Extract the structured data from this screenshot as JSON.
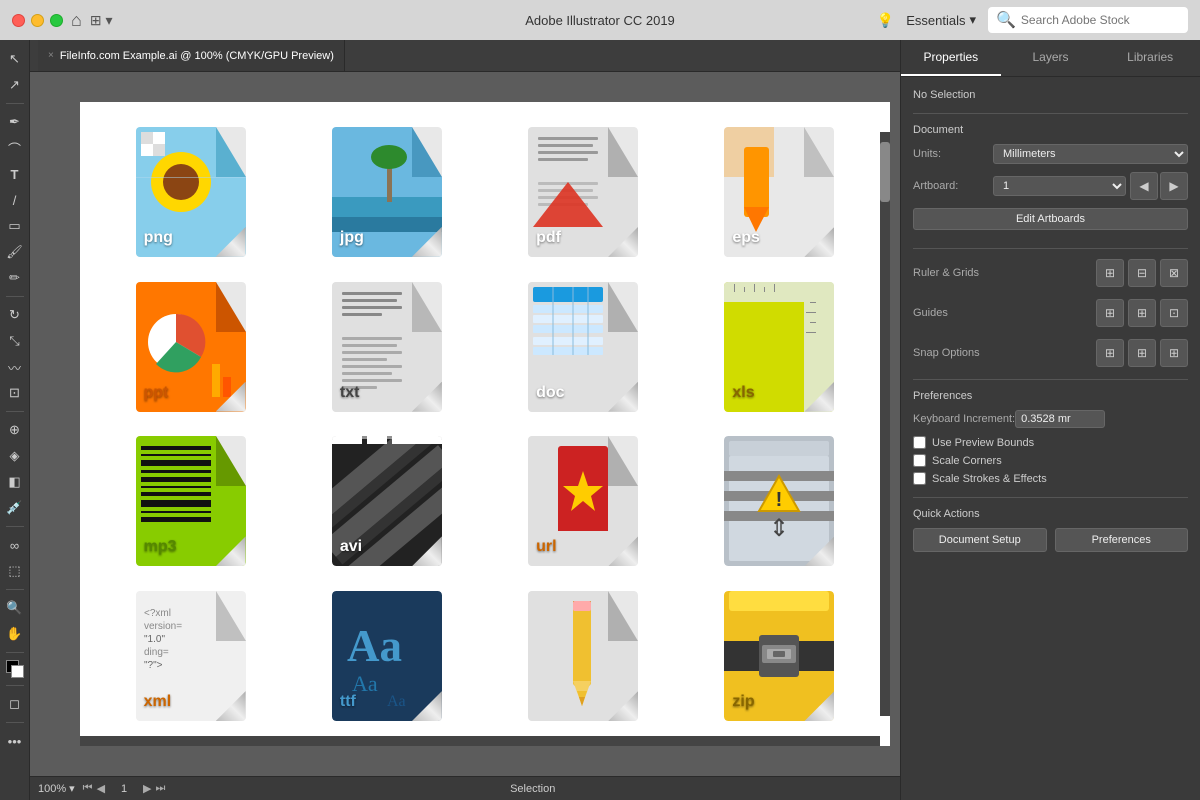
{
  "titlebar": {
    "title": "Adobe Illustrator CC 2019",
    "traffic": [
      "close",
      "minimize",
      "maximize"
    ],
    "home_label": "⌂",
    "grid_label": "⊞",
    "bulb_label": "💡",
    "essentials_label": "Essentials",
    "search_placeholder": "Search Adobe Stock"
  },
  "tab": {
    "label": "FileInfo.com Example.ai @ 100% (CMYK/GPU Preview)",
    "close": "×"
  },
  "bottom_bar": {
    "zoom": "100%",
    "artboard": "1",
    "selection": "Selection",
    "nav_prev_prev": "⏮",
    "nav_prev": "◀",
    "nav_next": "▶",
    "nav_next_next": "⏭"
  },
  "right_panel": {
    "tabs": [
      "Properties",
      "Layers",
      "Libraries"
    ],
    "active_tab": "Properties",
    "no_selection": "No Selection",
    "document_section": "Document",
    "units_label": "Units:",
    "units_value": "Millimeters",
    "artboard_label": "Artboard:",
    "artboard_value": "1",
    "edit_artboards_btn": "Edit Artboards",
    "ruler_grids": "Ruler & Grids",
    "guides": "Guides",
    "snap_options": "Snap Options",
    "preferences_section": "Preferences",
    "keyboard_increment_label": "Keyboard Increment:",
    "keyboard_increment_value": "0.3528 mr",
    "use_preview_bounds": "Use Preview Bounds",
    "scale_corners": "Scale Corners",
    "scale_strokes_effects": "Scale Strokes & Effects",
    "quick_actions": "Quick Actions",
    "document_setup_btn": "Document Setup",
    "preferences_btn": "Preferences"
  },
  "file_icons": [
    {
      "type": "png",
      "label": "png",
      "label_class": ""
    },
    {
      "type": "jpg",
      "label": "jpg",
      "label_class": ""
    },
    {
      "type": "pdf",
      "label": "pdf",
      "label_class": ""
    },
    {
      "type": "eps",
      "label": "eps",
      "label_class": ""
    },
    {
      "type": "ppt",
      "label": "ppt",
      "label_class": "orange"
    },
    {
      "type": "txt",
      "label": "txt",
      "label_class": "gray"
    },
    {
      "type": "doc",
      "label": "doc",
      "label_class": ""
    },
    {
      "type": "xls",
      "label": "xls",
      "label_class": "olive"
    },
    {
      "type": "mp3",
      "label": "mp3",
      "label_class": "green"
    },
    {
      "type": "avi",
      "label": "avi",
      "label_class": ""
    },
    {
      "type": "url",
      "label": "url",
      "label_class": "dark"
    },
    {
      "type": "sys",
      "label": "",
      "label_class": ""
    },
    {
      "type": "xml",
      "label": "xml",
      "label_class": "xml-color"
    },
    {
      "type": "ttf",
      "label": "ttf",
      "label_class": "ttf-color"
    },
    {
      "type": "pencil",
      "label": "",
      "label_class": ""
    },
    {
      "type": "zip",
      "label": "zip",
      "label_class": ""
    }
  ]
}
